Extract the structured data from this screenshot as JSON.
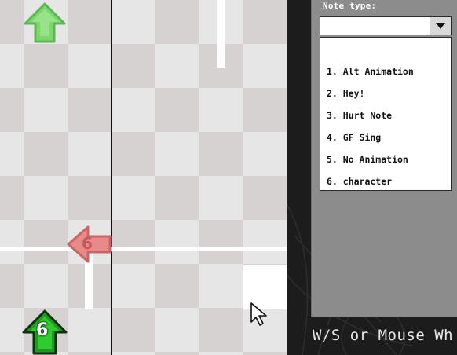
{
  "note_type": {
    "label": "Note type:",
    "selected_value": "",
    "options": [
      "1. Alt Animation",
      "2. Hey!",
      "3. Hurt Note",
      "4. GF Sing",
      "5. No Animation",
      "6. character"
    ]
  },
  "notes": {
    "left_arrow_number": "6",
    "up_arrow_number": "6"
  },
  "hint_text": "W/S or Mouse Wh",
  "colors": {
    "grid_dark": "#d6d2d2",
    "grid_light": "#e6e6e6",
    "panel": "#8c8c8c",
    "up_arrow_green": "#7dd86a",
    "selected_up_arrow": "#2ecc2e",
    "left_arrow_pink": "#e88a8a"
  },
  "icons": [
    "up-arrow-icon",
    "left-arrow-icon",
    "mouse-cursor-icon",
    "chevron-down-icon"
  ]
}
